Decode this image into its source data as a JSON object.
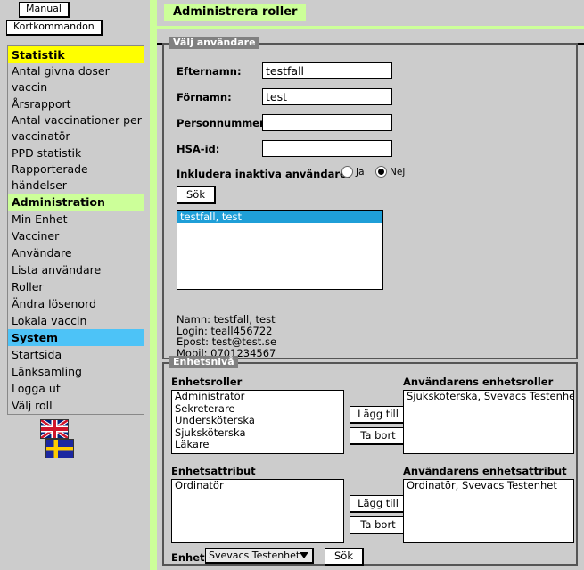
{
  "top_buttons": {
    "manual": "Manual",
    "shortcuts": "Kortkommandon"
  },
  "sidebar": {
    "items": [
      {
        "label": "Statistik",
        "type": "header",
        "highlight": "#ffff00"
      },
      {
        "label": "Antal givna doser vaccin",
        "type": "link"
      },
      {
        "label": "Årsrapport",
        "type": "link"
      },
      {
        "label": "Antal vaccinationer per vaccinatör",
        "type": "link"
      },
      {
        "label": "PPD statistik",
        "type": "link"
      },
      {
        "label": "Rapporterade händelser",
        "type": "link"
      },
      {
        "label": "Administration",
        "type": "header",
        "highlight": "#ccff99"
      },
      {
        "label": "Min Enhet",
        "type": "link"
      },
      {
        "label": "Vacciner",
        "type": "link"
      },
      {
        "label": "Användare",
        "type": "link"
      },
      {
        "label": "Lista användare",
        "type": "link"
      },
      {
        "label": "Roller",
        "type": "link"
      },
      {
        "label": "Ändra lösenord",
        "type": "link"
      },
      {
        "label": "Lokala vaccin",
        "type": "link"
      },
      {
        "label": "System",
        "type": "header",
        "highlight": "#4dc3f7"
      },
      {
        "label": "Startsida",
        "type": "link"
      },
      {
        "label": "Länksamling",
        "type": "link"
      },
      {
        "label": "Logga ut",
        "type": "link"
      },
      {
        "label": "Välj roll",
        "type": "link"
      }
    ],
    "flags": [
      {
        "name": "flag-uk",
        "title": "English"
      },
      {
        "name": "flag-se",
        "title": "Svenska"
      }
    ]
  },
  "page": {
    "title": "Administrera roller"
  },
  "select_user": {
    "legend": "Välj användare",
    "fields": [
      {
        "label": "Efternamn:",
        "value": "testfall",
        "placeholder": ""
      },
      {
        "label": "Förnamn:",
        "value": "test",
        "placeholder": ""
      },
      {
        "label": "Personnummer:",
        "value": "",
        "placeholder": ""
      },
      {
        "label": "HSA-id:",
        "value": "",
        "placeholder": ""
      }
    ],
    "include_inactive": {
      "label": "Inkludera inaktiva användare:",
      "options": [
        {
          "label": "Ja",
          "selected": false
        },
        {
          "label": "Nej",
          "selected": true
        }
      ]
    },
    "search_button": "Sök",
    "results": [
      {
        "label": "testfall, test",
        "selected": true
      }
    ],
    "details": {
      "name": "Namn: testfall, test",
      "login": "Login: teall456722",
      "email": "Epost: test@test.se",
      "mobile": "Mobil: 0701234567"
    }
  },
  "unit_level": {
    "legend": "Enhetsnivå",
    "roles": {
      "available_title": "Enhetsroller",
      "available": [
        "Administratör",
        "Sekreterare",
        "Undersköterska",
        "Sjuksköterska",
        "Läkare"
      ],
      "assigned_title": "Användarens enhetsroller",
      "assigned": [
        "Sjuksköterska, Svevacs Testenhet"
      ],
      "add_button": "Lägg till",
      "remove_button": "Ta bort"
    },
    "attributes": {
      "available_title": "Enhetsattribut",
      "available": [
        "Ordinatör"
      ],
      "assigned_title": "Användarens enhetsattribut",
      "assigned": [
        "Ordinatör, Svevacs Testenhet"
      ],
      "add_button": "Lägg till",
      "remove_button": "Ta bort"
    },
    "unit_picker": {
      "label": "Enhet",
      "selected": "Svevacs Testenhet",
      "search_button": "Sök"
    }
  }
}
